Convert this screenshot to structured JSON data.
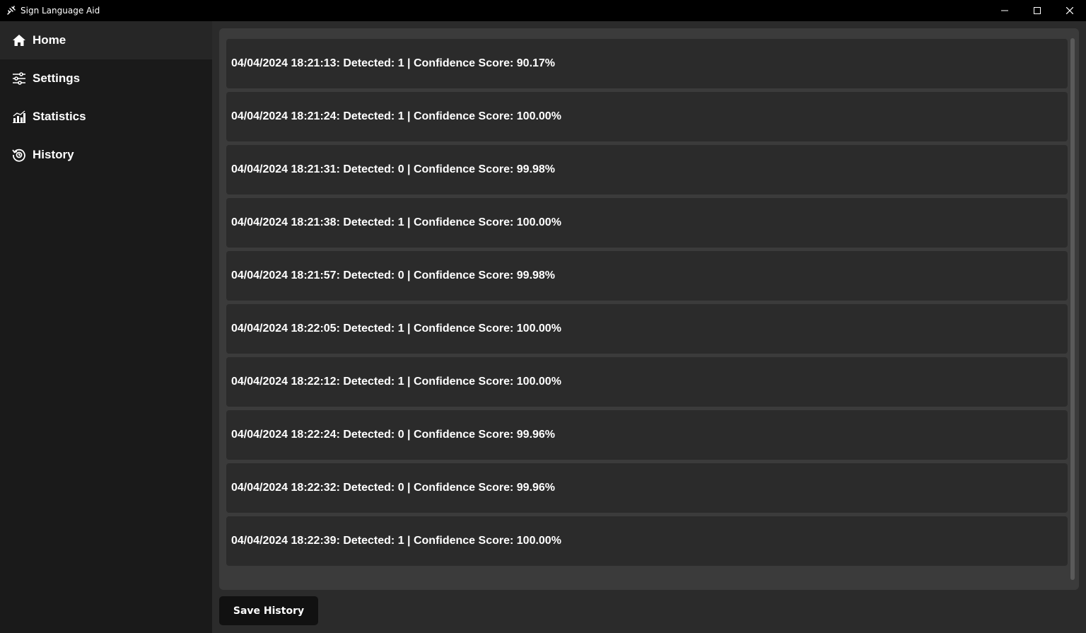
{
  "window": {
    "title": "Sign Language Aid",
    "controls": [
      "minimize-icon",
      "maximize-icon",
      "close-icon"
    ]
  },
  "sidebar": {
    "items": [
      {
        "label": "Home",
        "icon": "home-icon",
        "active": true
      },
      {
        "label": "Settings",
        "icon": "sliders-icon",
        "active": false
      },
      {
        "label": "Statistics",
        "icon": "bar-chart-icon",
        "active": false
      },
      {
        "label": "History",
        "icon": "history-icon",
        "active": false
      }
    ]
  },
  "history": {
    "entries": [
      "04/04/2024 18:21:13: Detected: 1 | Confidence Score: 90.17%",
      "04/04/2024 18:21:24: Detected: 1 | Confidence Score: 100.00%",
      "04/04/2024 18:21:31: Detected: 0 | Confidence Score: 99.98%",
      "04/04/2024 18:21:38: Detected: 1 | Confidence Score: 100.00%",
      "04/04/2024 18:21:57: Detected: 0 | Confidence Score: 99.98%",
      "04/04/2024 18:22:05: Detected: 1 | Confidence Score: 100.00%",
      "04/04/2024 18:22:12: Detected: 1 | Confidence Score: 100.00%",
      "04/04/2024 18:22:24: Detected: 0 | Confidence Score: 99.96%",
      "04/04/2024 18:22:32: Detected: 0 | Confidence Score: 99.96%",
      "04/04/2024 18:22:39: Detected: 1 | Confidence Score: 100.00%"
    ]
  },
  "actions": {
    "save_label": "Save History"
  },
  "colors": {
    "titlebar": "#000000",
    "sidebar": "#1a1a1a",
    "sidebar_active": "#262626",
    "main": "#2b2b2b",
    "frame": "#3b3b3b",
    "row": "#2b2b2b",
    "button": "#111111"
  }
}
